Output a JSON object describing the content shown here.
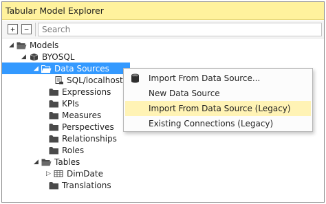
{
  "window": {
    "title": "Tabular Model Explorer"
  },
  "toolbar": {
    "expand_glyph": "+",
    "collapse_glyph": "−",
    "search_placeholder": "Search"
  },
  "tree": {
    "models": "Models",
    "byosql": "BYOSQL",
    "data_sources": "Data Sources",
    "sql_localhost": "SQL/localhost",
    "expressions": "Expressions",
    "kpis": "KPIs",
    "measures": "Measures",
    "perspectives": "Perspectives",
    "relationships": "Relationships",
    "roles": "Roles",
    "tables": "Tables",
    "dimdate": "DimDate",
    "translations": "Translations"
  },
  "context_menu": {
    "items": [
      {
        "label": "Import From Data Source...",
        "icon": "database-icon"
      },
      {
        "label": "New Data Source"
      },
      {
        "label": "Import From Data Source (Legacy)",
        "highlighted": true
      },
      {
        "label": "Existing Connections (Legacy)"
      }
    ]
  },
  "colors": {
    "title_bar": "#fff29d",
    "selection": "#3399ff",
    "menu_highlight": "#fff3b5"
  }
}
